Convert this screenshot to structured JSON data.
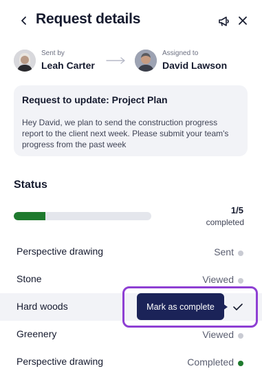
{
  "header": {
    "title": "Request details",
    "back_icon": "chevron-left-icon",
    "announce_icon": "megaphone-icon",
    "close_icon": "close-icon"
  },
  "people": {
    "sender_caption": "Sent by",
    "sender_name": "Leah Carter",
    "assignee_caption": "Assigned to",
    "assignee_name": "David Lawson"
  },
  "request": {
    "title": "Request to update: Project Plan",
    "body": "Hey David, we plan to send the construction progress report to the client next week. Please submit your team's progress from the past week"
  },
  "status": {
    "heading": "Status",
    "progress_count": "1/5",
    "progress_caption": "completed",
    "progress_fraction": 0.23,
    "tasks": [
      {
        "name": "Perspective drawing",
        "status": "Sent",
        "dot_color": "#c9cbd3"
      },
      {
        "name": "Stone",
        "status": "Viewed",
        "dot_color": "#c9cbd3"
      },
      {
        "name": "Hard woods",
        "status": "",
        "dot_color": ""
      },
      {
        "name": "Greenery",
        "status": "Viewed",
        "dot_color": "#c9cbd3"
      },
      {
        "name": "Perspective drawing",
        "status": "Completed",
        "dot_color": "#1f7a2e"
      }
    ]
  },
  "hover_action": {
    "mark_label": "Mark as complete",
    "check_icon": "check-icon"
  },
  "colors": {
    "accent_navy": "#1b2358",
    "progress_green": "#1f7a2e",
    "focus_purple": "#8e3fd3"
  }
}
